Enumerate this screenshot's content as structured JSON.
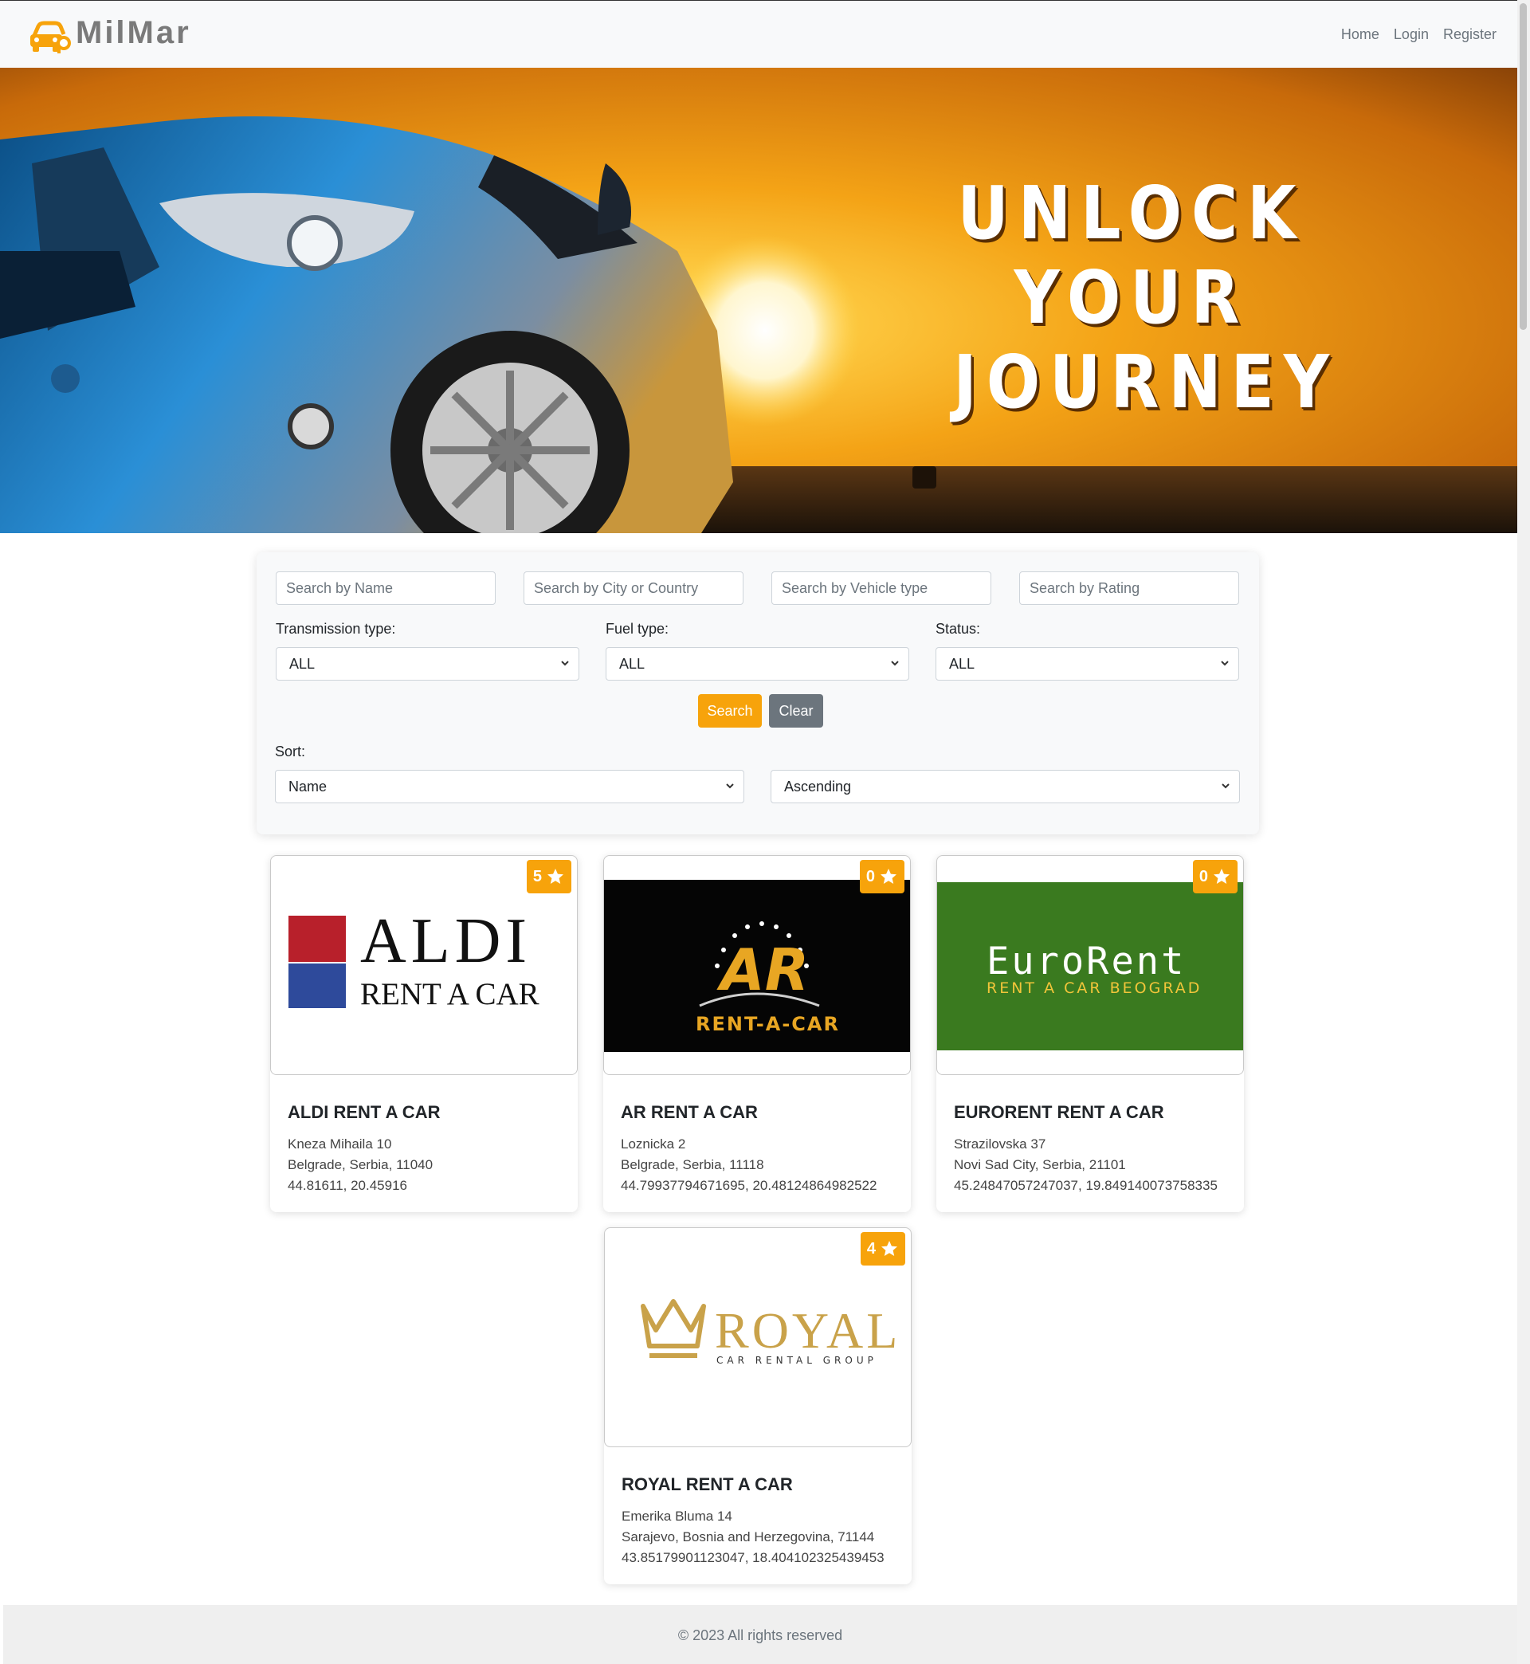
{
  "brand": {
    "name": "MilMar",
    "accent_color": "#f7a30b",
    "logo_icon": "car-key-icon"
  },
  "nav": {
    "home": "Home",
    "login": "Login",
    "register": "Register"
  },
  "hero": {
    "line1": "UNLOCK",
    "line2": "YOUR",
    "line3": "JOURNEY"
  },
  "filters": {
    "name_placeholder": "Search by Name",
    "location_placeholder": "Search by City or Country",
    "vehicle_placeholder": "Search by Vehicle type",
    "rating_placeholder": "Search by Rating",
    "transmission_label": "Transmission type:",
    "transmission_value": "ALL",
    "fuel_label": "Fuel type:",
    "fuel_value": "ALL",
    "status_label": "Status:",
    "status_value": "ALL",
    "search_button": "Search",
    "clear_button": "Clear",
    "sort_label": "Sort:",
    "sort_field": "Name",
    "sort_order": "Ascending"
  },
  "agencies": [
    {
      "name": "ALDI RENT A CAR",
      "rating": "5",
      "street": "Kneza Mihaila 10",
      "city_line": "Belgrade, Serbia, 11040",
      "coords": "44.81611, 20.45916",
      "logo": {
        "line1": "ALDI",
        "line2": "RENT A CAR"
      }
    },
    {
      "name": "AR RENT A CAR",
      "rating": "0",
      "street": "Loznicka 2",
      "city_line": "Belgrade, Serbia, 11118",
      "coords": "44.79937794671695, 20.48124864982522",
      "logo": {
        "line1": "AR",
        "line2": "RENT-A-CAR"
      }
    },
    {
      "name": "EURORENT RENT A CAR",
      "rating": "0",
      "street": "Strazilovska 37",
      "city_line": "Novi Sad City, Serbia, 21101",
      "coords": "45.24847057247037, 19.849140073758335",
      "logo": {
        "line1": "EuroRent",
        "line2": "RENT A CAR BEOGRAD"
      }
    },
    {
      "name": "ROYAL RENT A CAR",
      "rating": "4",
      "street": "Emerika Bluma 14",
      "city_line": "Sarajevo, Bosnia and Herzegovina, 71144",
      "coords": "43.85179901123047, 18.404102325439453",
      "logo": {
        "line1": "ROYAL",
        "line2": "CAR RENTAL GROUP"
      }
    }
  ],
  "footer": {
    "text": "© 2023 All rights reserved"
  }
}
